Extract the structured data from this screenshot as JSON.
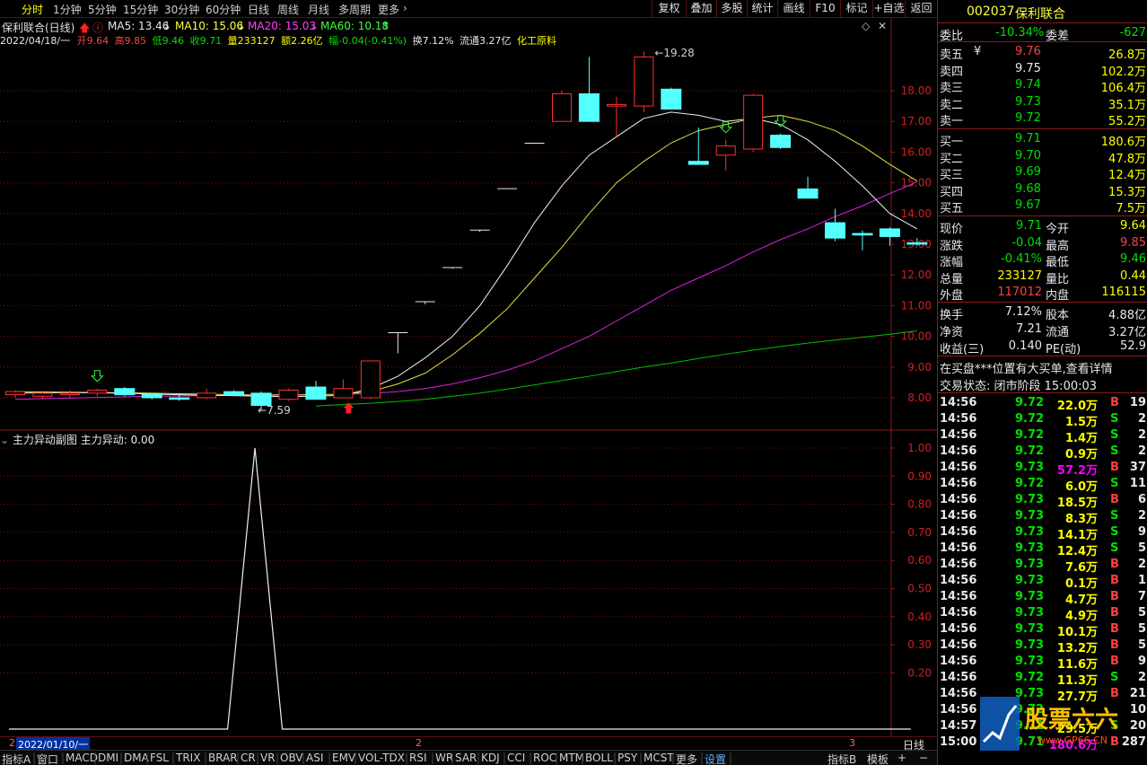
{
  "toolbar": {
    "periods": [
      "分时",
      "1分钟",
      "5分钟",
      "15分钟",
      "30分钟",
      "60分钟",
      "日线",
      "周线",
      "月线",
      "多周期",
      "更多"
    ],
    "buttons": [
      "复权",
      "叠加",
      "多股",
      "统计",
      "画线",
      "F10",
      "标记",
      "+自选",
      "返回"
    ]
  },
  "chart_header": {
    "name": "保利联合(日线)",
    "ma5": "MA5: 13.46",
    "ma10": "MA10: 15.06",
    "ma20": "MA20: 15.03",
    "ma60": "MA60: 10.18"
  },
  "info_line": {
    "date": "2022/04/18/一",
    "open": "开9.64",
    "high": "高9.85",
    "low": "低9.46",
    "close": "收9.71",
    "volume": "量233127",
    "amount": "额2.26亿",
    "change": "幅-0.04(-0.41%)",
    "turnover": "换7.12%",
    "float_cap": "流通3.27亿",
    "sector": "化工原料"
  },
  "main_chart": {
    "price_axis": [
      "18.00",
      "17.00",
      "16.00",
      "15.00",
      "14.00",
      "13.00",
      "12.00",
      "11.00",
      "10.00",
      "9.00",
      "8.00"
    ],
    "high_label": "19.28",
    "low_label": "7.59"
  },
  "sub_chart": {
    "title": "主力异动副图",
    "indicator": "主力异动: 0.00",
    "axis": [
      "1.00",
      "0.90",
      "0.80",
      "0.70",
      "0.60",
      "0.50",
      "0.40",
      "0.30",
      "0.20"
    ]
  },
  "bottom_axis": {
    "start_marker": "2",
    "start_date": "2022/01/10/一",
    "mid_marker": "2",
    "end_marker": "3",
    "period": "日线"
  },
  "tabs": {
    "items": [
      "指标A",
      "窗口",
      "MACD",
      "DMI",
      "DMA",
      "FSL",
      "TRIX",
      "BRAR",
      "CR",
      "VR",
      "OBV",
      "ASI",
      "EMV",
      "VOL-TDX",
      "RSI",
      "WR",
      "SAR",
      "KDJ",
      "CCI",
      "ROC",
      "MTM",
      "BOLL",
      "PSY",
      "MCST",
      "更多",
      "设置"
    ],
    "right": [
      "指标B",
      "模板",
      "+",
      "−"
    ]
  },
  "quote": {
    "code": "002037",
    "name": "保利联合",
    "weibi_label": "委比",
    "weibi_value": "-10.34%",
    "weicha_label": "委差",
    "weicha_value": "-627",
    "asks": [
      {
        "label": "卖五",
        "price": "9.76",
        "vol": "26.8万"
      },
      {
        "label": "卖四",
        "price": "9.75",
        "vol": "102.2万"
      },
      {
        "label": "卖三",
        "price": "9.74",
        "vol": "106.4万"
      },
      {
        "label": "卖二",
        "price": "9.73",
        "vol": "35.1万"
      },
      {
        "label": "卖一",
        "price": "9.72",
        "vol": "55.2万"
      }
    ],
    "ask_mark": "¥",
    "bids": [
      {
        "label": "买一",
        "price": "9.71",
        "vol": "180.6万"
      },
      {
        "label": "买二",
        "price": "9.70",
        "vol": "47.8万"
      },
      {
        "label": "买三",
        "price": "9.69",
        "vol": "12.4万"
      },
      {
        "label": "买四",
        "price": "9.68",
        "vol": "15.3万"
      },
      {
        "label": "买五",
        "price": "9.67",
        "vol": "7.5万"
      }
    ],
    "stats": [
      {
        "l1": "现价",
        "v1": "9.71",
        "l2": "今开",
        "v2": "9.64"
      },
      {
        "l1": "涨跌",
        "v1": "-0.04",
        "l2": "最高",
        "v2": "9.85"
      },
      {
        "l1": "涨幅",
        "v1": "-0.41%",
        "l2": "最低",
        "v2": "9.46"
      },
      {
        "l1": "总量",
        "v1": "233127",
        "l2": "量比",
        "v2": "0.44"
      },
      {
        "l1": "外盘",
        "v1": "117012",
        "l2": "内盘",
        "v2": "116115"
      }
    ],
    "stats2": [
      {
        "l1": "换手",
        "v1": "7.12%",
        "l2": "股本",
        "v2": "4.88亿"
      },
      {
        "l1": "净资",
        "v1": "7.21",
        "l2": "流通",
        "v2": "3.27亿"
      },
      {
        "l1": "收益(三)",
        "v1": "0.140",
        "l2": "PE(动)",
        "v2": "52.9"
      }
    ],
    "notice": "在买盘***位置有大买单,查看详情",
    "status": "交易状态: 闭市阶段 15:00:03",
    "trades": [
      {
        "t": "14:56",
        "p": "9.72",
        "v": "22.0万",
        "d": "B",
        "n": "19"
      },
      {
        "t": "14:56",
        "p": "9.72",
        "v": "1.5万",
        "d": "S",
        "n": "2"
      },
      {
        "t": "14:56",
        "p": "9.72",
        "v": "1.4万",
        "d": "S",
        "n": "2"
      },
      {
        "t": "14:56",
        "p": "9.72",
        "v": "0.9万",
        "d": "S",
        "n": "2"
      },
      {
        "t": "14:56",
        "p": "9.73",
        "v": "57.2万",
        "d": "B",
        "n": "37"
      },
      {
        "t": "14:56",
        "p": "9.72",
        "v": "6.0万",
        "d": "S",
        "n": "11"
      },
      {
        "t": "14:56",
        "p": "9.73",
        "v": "18.5万",
        "d": "B",
        "n": "6"
      },
      {
        "t": "14:56",
        "p": "9.73",
        "v": "8.3万",
        "d": "S",
        "n": "2"
      },
      {
        "t": "14:56",
        "p": "9.73",
        "v": "14.1万",
        "d": "S",
        "n": "9"
      },
      {
        "t": "14:56",
        "p": "9.73",
        "v": "12.4万",
        "d": "S",
        "n": "5"
      },
      {
        "t": "14:56",
        "p": "9.73",
        "v": "7.6万",
        "d": "B",
        "n": "2"
      },
      {
        "t": "14:56",
        "p": "9.73",
        "v": "0.1万",
        "d": "B",
        "n": "1"
      },
      {
        "t": "14:56",
        "p": "9.73",
        "v": "4.7万",
        "d": "B",
        "n": "7"
      },
      {
        "t": "14:56",
        "p": "9.73",
        "v": "4.9万",
        "d": "B",
        "n": "5"
      },
      {
        "t": "14:56",
        "p": "9.73",
        "v": "10.1万",
        "d": "B",
        "n": "5"
      },
      {
        "t": "14:56",
        "p": "9.73",
        "v": "13.2万",
        "d": "B",
        "n": "5"
      },
      {
        "t": "14:56",
        "p": "9.73",
        "v": "11.6万",
        "d": "B",
        "n": "9"
      },
      {
        "t": "14:56",
        "p": "9.72",
        "v": "11.3万",
        "d": "S",
        "n": "2"
      },
      {
        "t": "14:56",
        "p": "9.73",
        "v": "27.7万",
        "d": "B",
        "n": "21"
      },
      {
        "t": "14:56",
        "p": "9.72",
        "v": "",
        "d": "",
        "n": "10"
      },
      {
        "t": "14:57",
        "p": "9.72",
        "v": "29.5万",
        "d": "S",
        "n": "20"
      },
      {
        "t": "15:00",
        "p": "9.71",
        "v": "180.6万",
        "d": "B",
        "n": "287"
      }
    ]
  },
  "watermark": {
    "brand": "股票六六",
    "url": "www.GP66.CN"
  },
  "candles": [
    {
      "o": 8.1,
      "h": 8.25,
      "l": 8.0,
      "c": 8.2
    },
    {
      "o": 8.05,
      "h": 8.2,
      "l": 7.95,
      "c": 8.15
    },
    {
      "o": 8.1,
      "h": 8.25,
      "l": 8.0,
      "c": 8.15
    },
    {
      "o": 8.15,
      "h": 8.3,
      "l": 8.05,
      "c": 8.25
    },
    {
      "o": 8.3,
      "h": 8.35,
      "l": 8.05,
      "c": 8.1
    },
    {
      "o": 8.1,
      "h": 8.15,
      "l": 7.95,
      "c": 8.0
    },
    {
      "o": 8.0,
      "h": 8.1,
      "l": 7.9,
      "c": 7.95
    },
    {
      "o": 8.0,
      "h": 8.3,
      "l": 7.95,
      "c": 8.15
    },
    {
      "o": 8.2,
      "h": 8.25,
      "l": 8.05,
      "c": 8.1
    },
    {
      "o": 8.15,
      "h": 8.2,
      "l": 7.59,
      "c": 7.75
    },
    {
      "o": 7.95,
      "h": 8.3,
      "l": 7.9,
      "c": 8.25
    },
    {
      "o": 8.35,
      "h": 8.55,
      "l": 7.95,
      "c": 7.95
    },
    {
      "o": 8.0,
      "h": 8.6,
      "l": 8.0,
      "c": 8.3
    },
    {
      "o": 8.0,
      "h": 8.9,
      "l": 7.95,
      "c": 9.2
    },
    {
      "o": 10.12,
      "h": 10.12,
      "l": 9.45,
      "c": 10.12
    },
    {
      "o": 11.13,
      "h": 11.13,
      "l": 11.05,
      "c": 11.13
    },
    {
      "o": 12.24,
      "h": 12.24,
      "l": 12.2,
      "c": 12.24
    },
    {
      "o": 13.46,
      "h": 13.46,
      "l": 13.4,
      "c": 13.46
    },
    {
      "o": 14.81,
      "h": 14.81,
      "l": 14.8,
      "c": 14.81
    },
    {
      "o": 16.29,
      "h": 16.29,
      "l": 16.28,
      "c": 16.29
    },
    {
      "o": 17.0,
      "h": 18.0,
      "l": 17.0,
      "c": 17.9
    },
    {
      "o": 17.9,
      "h": 19.1,
      "l": 17.0,
      "c": 17.0
    },
    {
      "o": 17.5,
      "h": 17.8,
      "l": 16.5,
      "c": 17.55
    },
    {
      "o": 17.5,
      "h": 19.28,
      "l": 17.3,
      "c": 19.1
    },
    {
      "o": 18.05,
      "h": 18.1,
      "l": 17.4,
      "c": 17.4
    },
    {
      "o": 15.7,
      "h": 16.8,
      "l": 15.6,
      "c": 15.6
    },
    {
      "o": 15.9,
      "h": 16.4,
      "l": 15.4,
      "c": 16.2
    },
    {
      "o": 16.1,
      "h": 17.9,
      "l": 16.0,
      "c": 17.85
    },
    {
      "o": 16.55,
      "h": 16.6,
      "l": 16.1,
      "c": 16.15
    },
    {
      "o": 14.8,
      "h": 15.2,
      "l": 14.5,
      "c": 14.5
    },
    {
      "o": 13.7,
      "h": 14.15,
      "l": 13.1,
      "c": 13.2
    },
    {
      "o": 13.35,
      "h": 13.45,
      "l": 12.8,
      "c": 13.3
    },
    {
      "o": 13.5,
      "h": 13.55,
      "l": 12.95,
      "c": 13.25
    },
    {
      "o": 13.05,
      "h": 13.2,
      "l": 12.95,
      "c": 13.0
    }
  ],
  "ma5": [
    8.15,
    8.16,
    8.17,
    8.16,
    8.15,
    8.12,
    8.1,
    8.08,
    8.07,
    8.05,
    8.04,
    8.05,
    8.08,
    8.3,
    8.7,
    9.3,
    10.0,
    11.0,
    12.3,
    13.7,
    14.9,
    15.9,
    16.5,
    17.1,
    17.3,
    17.2,
    17.0,
    17.1,
    16.9,
    16.4,
    15.7,
    14.9,
    14.0,
    13.5
  ],
  "ma10": [
    8.2,
    8.19,
    8.18,
    8.17,
    8.16,
    8.15,
    8.13,
    8.12,
    8.1,
    8.09,
    8.09,
    8.1,
    8.12,
    8.2,
    8.45,
    8.8,
    9.4,
    10.1,
    10.9,
    11.9,
    12.9,
    14.0,
    15.0,
    15.7,
    16.3,
    16.7,
    16.9,
    17.1,
    17.2,
    17.0,
    16.7,
    16.2,
    15.6,
    15.06
  ],
  "ma20": [
    7.95,
    7.97,
    7.99,
    8.01,
    8.03,
    8.05,
    8.06,
    8.07,
    8.08,
    8.09,
    8.1,
    8.1,
    8.11,
    8.14,
    8.2,
    8.3,
    8.45,
    8.65,
    8.9,
    9.2,
    9.6,
    10.0,
    10.5,
    11.0,
    11.5,
    11.9,
    12.3,
    12.75,
    13.15,
    13.5,
    13.9,
    14.25,
    14.65,
    15.03
  ],
  "ma60": [
    null,
    null,
    null,
    null,
    null,
    null,
    null,
    null,
    null,
    null,
    null,
    7.73,
    7.78,
    7.82,
    7.88,
    7.95,
    8.05,
    8.15,
    8.28,
    8.42,
    8.56,
    8.7,
    8.85,
    9.0,
    9.13,
    9.28,
    9.42,
    9.55,
    9.67,
    9.78,
    9.88,
    9.97,
    10.07,
    10.18
  ],
  "sub_values": [
    0,
    0,
    0,
    0,
    0,
    0,
    0,
    0,
    0,
    1,
    0,
    0,
    0,
    0,
    0,
    0,
    0,
    0,
    0,
    0,
    0,
    0,
    0,
    0,
    0,
    0,
    0,
    0,
    0,
    0,
    0,
    0,
    0,
    0
  ],
  "signals": {
    "green_arrows": [
      3,
      26,
      28
    ],
    "red_arrow": 12
  }
}
